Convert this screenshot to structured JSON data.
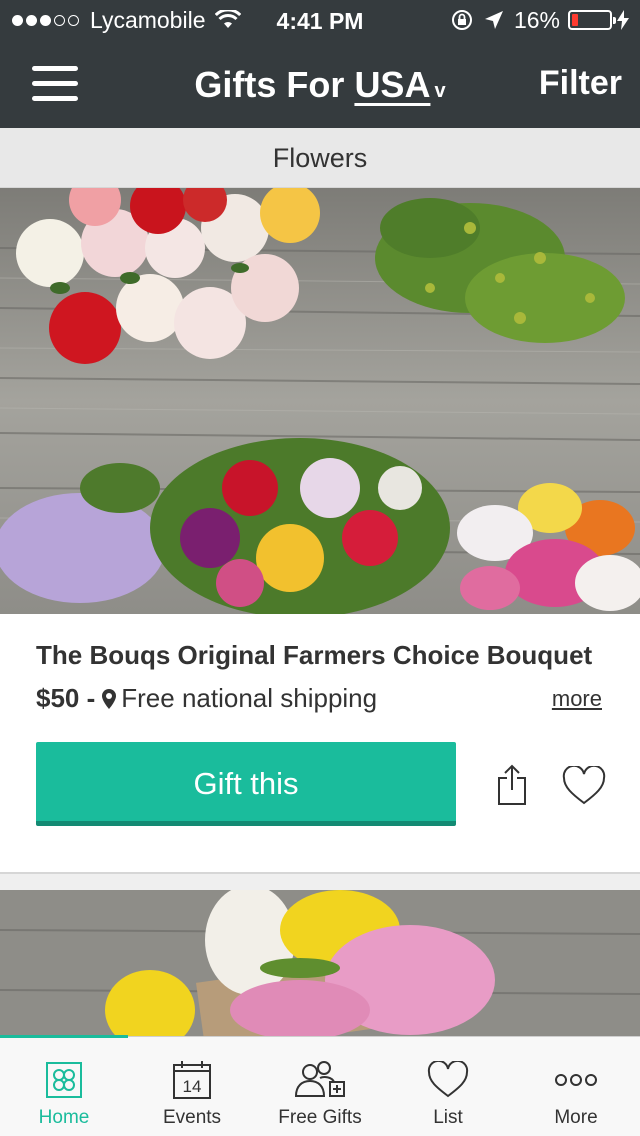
{
  "status_bar": {
    "carrier": "Lycamobile",
    "time": "4:41 PM",
    "battery": "16%",
    "battery_level": 0.16,
    "signal_icon": "signal-dots",
    "wifi_icon": "wifi-icon"
  },
  "nav": {
    "title_prefix": "Gifts For",
    "country": "USA",
    "caret": "v",
    "filter_label": "Filter"
  },
  "category": {
    "title": "Flowers"
  },
  "product": {
    "title": "The Bouqs Original Farmers Choice Bouquet",
    "price": "$50 -",
    "shipping": "Free national shipping",
    "more_label": "more",
    "gift_label": "Gift this"
  },
  "tabs": [
    {
      "label": "Home",
      "icon": "home-icon",
      "active": true
    },
    {
      "label": "Events",
      "icon": "calendar-icon",
      "calendar_day": "14",
      "active": false
    },
    {
      "label": "Free Gifts",
      "icon": "free-gifts-icon",
      "active": false
    },
    {
      "label": "List",
      "icon": "heart-icon",
      "active": false
    },
    {
      "label": "More",
      "icon": "more-icon",
      "active": false
    }
  ],
  "colors": {
    "accent": "#1abc9c",
    "header_bg": "#353b3e",
    "category_bg": "#e8e8e8"
  }
}
